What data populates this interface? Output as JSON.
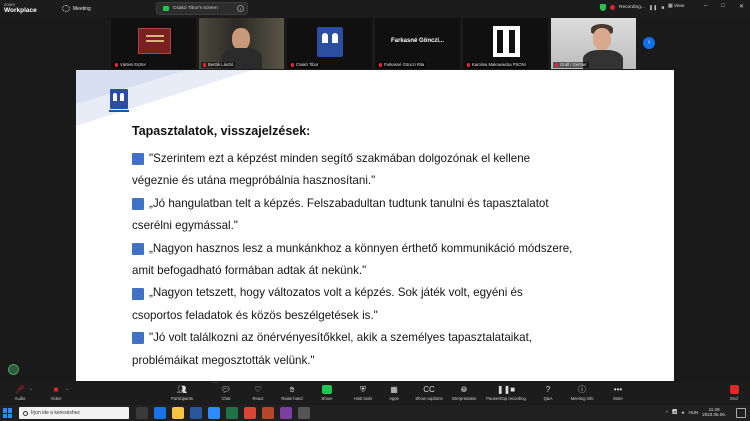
{
  "app": {
    "brand_small": "zoom",
    "brand_large": "Workplace",
    "meeting_label": "Meeting",
    "screen_pill": "Csakó Tibor's screen",
    "recording": "Recording...",
    "view": "View"
  },
  "window_controls": [
    "–",
    "□",
    "✕"
  ],
  "participants": [
    {
      "name": "Vártesi Eszter",
      "active": false
    },
    {
      "name": "Bertók László",
      "active": true
    },
    {
      "name": "Csakó Tibor",
      "active": false
    },
    {
      "name": "Farkasné Gönczi Rita",
      "active": false,
      "display_text": "Farkasné Gönczi..."
    },
    {
      "name": "Karolina Makowiecka PSONI",
      "active": false
    },
    {
      "name": "Grafl / Gertner",
      "active": false
    }
  ],
  "slide": {
    "title": "Tapasztalatok, visszajelzések:",
    "lines": [
      {
        "bullet": true,
        "text": "\"Szerintem ezt a képzést minden segítő szakmában dolgozónak el kellene"
      },
      {
        "bullet": false,
        "text": "végeznie és utána megpróbálnia hasznosítani.\""
      },
      {
        "bullet": true,
        "text": "„Jó hangulatban telt a képzés. Felszabadultan tudtunk tanulni és tapasztalatot"
      },
      {
        "bullet": false,
        "text": "cserélni egymással.\""
      },
      {
        "bullet": true,
        "text": "„Nagyon hasznos lesz a munkánkhoz a könnyen érthető kommunikáció módszere,"
      },
      {
        "bullet": false,
        "text": "amit befogadható formában adtak át nekünk.\""
      },
      {
        "bullet": true,
        "text": "„Nagyon tetszett, hogy változatos volt a képzés. Sok játék volt, egyéni és"
      },
      {
        "bullet": false,
        "text": "csoportos feladatok és közös beszélgetések is.\""
      },
      {
        "bullet": true,
        "text": "\"Jó volt találkozni az önérvényesítőkkel, akik a személyes tapasztalataikat,"
      },
      {
        "bullet": false,
        "text": "problémáikat megosztották velünk.\""
      }
    ]
  },
  "toolbar": {
    "audio": "Audio",
    "video": "Video",
    "participants": "Participants",
    "chat": "Chat",
    "react": "React",
    "raise_hand": "Raise hand",
    "share": "Share",
    "host_tools": "Host tools",
    "apps": "Apps",
    "show_captions": "Show captions",
    "interpretation": "Interpretation",
    "pause_recording": "Pause/stop recording",
    "qa": "Q&A",
    "meeting_info": "Meeting info",
    "more": "More",
    "end": "End",
    "participants_count": "2"
  },
  "taskbar": {
    "search_placeholder": "Írjon ide a kereséshez",
    "lang": "HUN",
    "time": "11:28",
    "date": "2023.06.06."
  },
  "colors": {
    "accent_blue": "#0e71eb",
    "active_green": "#2ab24a",
    "bullet_blue": "#3f72c5",
    "logo_blue": "#2b4ea0",
    "red": "#e02828"
  }
}
